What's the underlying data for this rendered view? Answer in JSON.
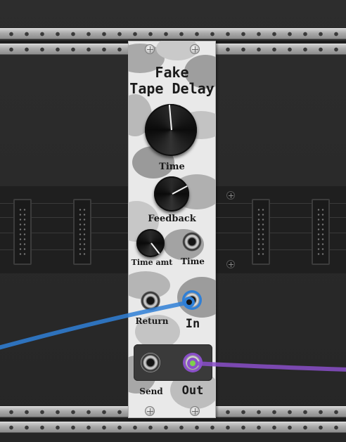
{
  "module": {
    "title_line1": "Fake",
    "title_line2": "Tape Delay",
    "knobs": {
      "time_label": "Time",
      "feedback_label": "Feedback",
      "time_amt_label": "Time amt"
    },
    "jacks": {
      "time_cv_label": "Time",
      "return_label": "Return",
      "in_label": "In",
      "send_label": "Send",
      "out_label": "Out"
    },
    "colors": {
      "panel": "#e9e9e9",
      "in_cable": "#2f7fd6",
      "out_cable": "#8a4fc9",
      "out_plug_center": "#7dd14a"
    }
  }
}
